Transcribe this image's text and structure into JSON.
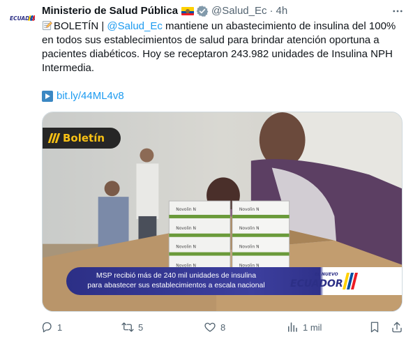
{
  "tweet": {
    "author_name": "Ministerio de Salud Pública",
    "handle": "@Salud_Ec",
    "separator": "·",
    "time": "4h",
    "avatar_text": "ECUADOR",
    "text_prefix": "BOLETÍN | ",
    "mention": "@Salud_Ec",
    "text_body": " mantiene un abastecimiento de insulina del 100% en todos sus establecimientos de salud para brindar atención oportuna a pacientes diabéticos. Hoy se receptaron 243.982 unidades de Insulina NPH Intermedia.",
    "link": "bit.ly/44ML4v8"
  },
  "media": {
    "badge_label": "Boletín",
    "caption_line1": "MSP recibió más de 240 mil unidades de insulina",
    "caption_line2": "para abastecer sus establecimientos a escala nacional",
    "logo_small": "EL NUEVO",
    "logo_main": "ECUADOR",
    "box_label": "Novolin N",
    "colors": {
      "badge_yellow": "#f6c015",
      "caption_blue": "#2c2f86"
    }
  },
  "actions": {
    "reply_count": "1",
    "retweet_count": "5",
    "like_count": "8",
    "views_count": "1 mil"
  },
  "icons": {
    "verified": "verified-badge-icon",
    "more": "more-icon",
    "reply": "reply-icon",
    "retweet": "retweet-icon",
    "like": "heart-icon",
    "views": "views-icon",
    "bookmark": "bookmark-icon",
    "share": "share-icon"
  }
}
